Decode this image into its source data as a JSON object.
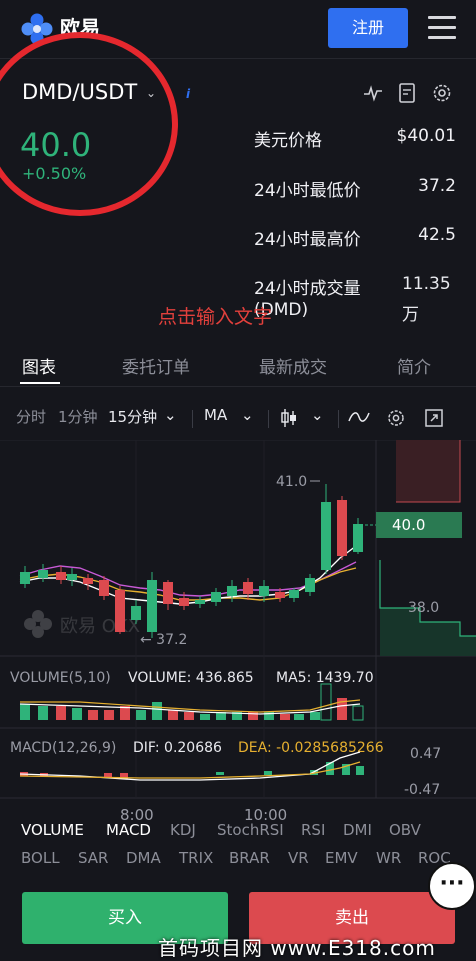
{
  "header": {
    "logo_text": "欧易",
    "register_label": "注册"
  },
  "ticker": {
    "pair": "DMD/USDT",
    "info": "i",
    "price": "40.0",
    "change": "+0.50%",
    "stats": [
      {
        "label": "美元价格",
        "value": "$40.01"
      },
      {
        "label": "24小时最低价",
        "value": "37.2"
      },
      {
        "label": "24小时最高价",
        "value": "42.5"
      },
      {
        "label": "24小时成交量",
        "label2": "(DMD)",
        "value": "11.35",
        "value2": "万"
      }
    ]
  },
  "annotation": {
    "hint": "点击输入文字"
  },
  "tabs": [
    "图表",
    "委托订单",
    "最新成交",
    "简介"
  ],
  "toolbar": {
    "timeshare": "分时",
    "one_min": "1分钟",
    "fifteen_min": "15分钟",
    "ma": "MA"
  },
  "chart": {
    "high_label": "41.0",
    "low_label": "← 37.2",
    "current_price": "40.0",
    "axis_38": "38.0",
    "watermark": "欧易 OKX",
    "volume_title": "VOLUME(5,10)",
    "volume_value": "VOLUME: 436.865",
    "volume_ma5": "MA5: 1439.70",
    "macd_title": "MACD(12,26,9)",
    "macd_dif": "DIF: 0.20686",
    "macd_dea": "DEA: -0.0285685266",
    "macd_axis_top": "0.47",
    "macd_axis_bottom": "-0.47",
    "time_labels": [
      "8:00",
      "10:00"
    ]
  },
  "indicators_main": [
    "VOLUME",
    "MACD",
    "KDJ",
    "StochRSI",
    "RSI",
    "DMI",
    "OBV"
  ],
  "indicators_sub": [
    "BOLL",
    "SAR",
    "DMA",
    "TRIX",
    "BRAR",
    "VR",
    "EMV",
    "WR",
    "ROC"
  ],
  "actions": {
    "buy": "买入",
    "sell": "卖出",
    "more": "···"
  },
  "footer": {
    "watermark": "首码项目网 www.E318.com"
  },
  "colors": {
    "up": "#2fb37a",
    "down": "#dc4a4f",
    "accent": "#2f6ff0",
    "annotation": "#e5282e"
  }
}
